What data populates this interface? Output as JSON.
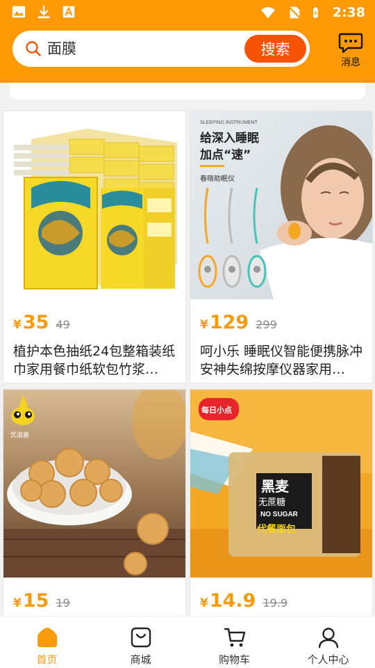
{
  "status_bar": {
    "time": "2:38",
    "icons": [
      "image-icon",
      "download-icon",
      "a-icon",
      "wifi-icon",
      "no-sim-icon",
      "battery-charging-icon"
    ]
  },
  "search": {
    "value": "面膜",
    "button_label": "搜索"
  },
  "message": {
    "label": "消息"
  },
  "products": [
    {
      "currency": "¥",
      "price": "35",
      "original_price": "49",
      "title": "植护本色抽纸24包整箱装纸巾家用餐巾纸软包竹浆…"
    },
    {
      "currency": "¥",
      "price": "129",
      "original_price": "299",
      "title": "呵小乐 睡眠仪智能便携脉冲安神失绵按摩仪器家用…",
      "image_text": {
        "top": "SLEEPING INSTRUMENT",
        "headline1": "给深入睡眠",
        "headline2": "加点“速”",
        "sub": "春晓助眠仪"
      }
    },
    {
      "currency": "¥",
      "price": "15",
      "original_price": "19",
      "title": "",
      "image_text": {
        "logo": "优滋嘉"
      }
    },
    {
      "currency": "¥",
      "price": "14.9",
      "original_price": "19.9",
      "title": "",
      "image_text": {
        "logo": "每日小点",
        "line1": "黑麦",
        "line2": "无蔗糖",
        "line3": "NO SUGAR",
        "line4": "代餐面包"
      }
    }
  ],
  "bottom_nav": [
    {
      "label": "首页",
      "icon": "home-icon",
      "active": true
    },
    {
      "label": "商城",
      "icon": "shopping-bag-icon",
      "active": false
    },
    {
      "label": "购物车",
      "icon": "cart-icon",
      "active": false
    },
    {
      "label": "个人中心",
      "icon": "person-icon",
      "active": false
    }
  ],
  "colors": {
    "header": "#fd9904",
    "search_button": "#f65306",
    "price": "#f79b0c",
    "active_nav": "#f79b0c"
  }
}
